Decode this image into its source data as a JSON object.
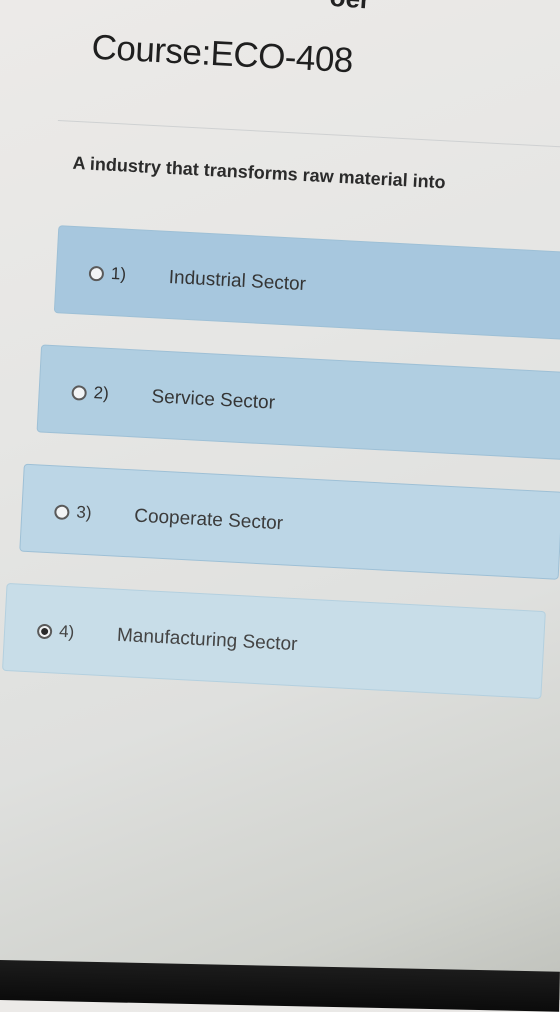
{
  "page": {
    "top_fragment": "oer",
    "course_title": "Course:ECO-408",
    "question": "A industry that transforms raw material into"
  },
  "options": [
    {
      "number": "1)",
      "label": "Industrial Sector",
      "selected": false
    },
    {
      "number": "2)",
      "label": "Service Sector",
      "selected": false
    },
    {
      "number": "3)",
      "label": "Cooperate Sector",
      "selected": false
    },
    {
      "number": "4)",
      "label": "Manufacturing Sector",
      "selected": true
    }
  ],
  "colors": {
    "option_bg": "#a7c7de",
    "title_text": "#1f1f1f",
    "monitor_bezel": "#111111"
  },
  "icons": {
    "unselected": "radio-unchecked-icon",
    "selected": "radio-checked-icon"
  }
}
